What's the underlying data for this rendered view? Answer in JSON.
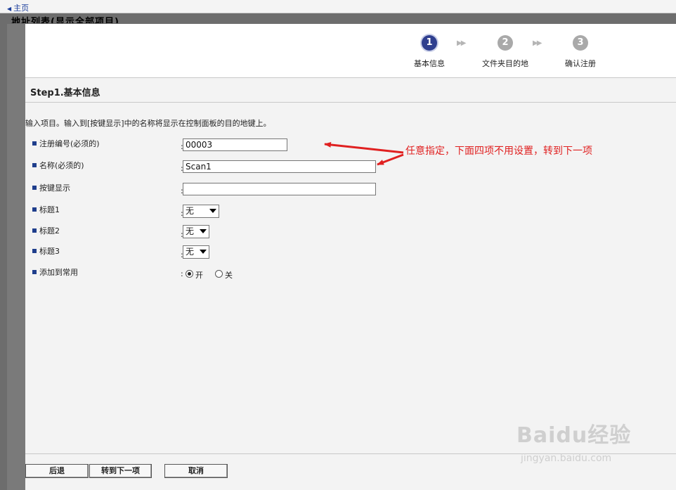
{
  "nav": {
    "home_label": "主页"
  },
  "background_title": "地址列表(显示全部项目)",
  "stepper": {
    "steps": [
      {
        "number": "1",
        "label": "基本信息"
      },
      {
        "number": "2",
        "label": "文件夹目的地"
      },
      {
        "number": "3",
        "label": "确认注册"
      }
    ]
  },
  "section_title": "Step1.基本信息",
  "instruction": "输入项目。输入到[按键显示]中的名称将显示在控制面板的目的地键上。",
  "colon": ":",
  "form": {
    "reg_no": {
      "label": "注册编号(必须的)",
      "value": "00003"
    },
    "name": {
      "label": "名称(必须的)",
      "value": "Scan1"
    },
    "key_display": {
      "label": "按键显示",
      "value": ""
    },
    "title1": {
      "label": "标题1",
      "value": "无"
    },
    "title2": {
      "label": "标题2",
      "value": "无"
    },
    "title3": {
      "label": "标题3",
      "value": "无"
    },
    "add_to_freq": {
      "label": "添加到常用",
      "option_on": "开",
      "option_off": "关",
      "selected": "开"
    }
  },
  "annotation": "任意指定，下面四项不用设置，转到下一项",
  "buttons": {
    "back": "后退",
    "next": "转到下一项",
    "cancel": "取消"
  },
  "watermark": {
    "main": "Baidu经验",
    "sub": "jingyan.baidu.com"
  },
  "colors": {
    "link": "#1a3d9c",
    "step_active": "#2f3f8f",
    "step_inactive": "#a9a9a9",
    "annotation": "#e02020",
    "bullet": "#1f3e8c"
  }
}
